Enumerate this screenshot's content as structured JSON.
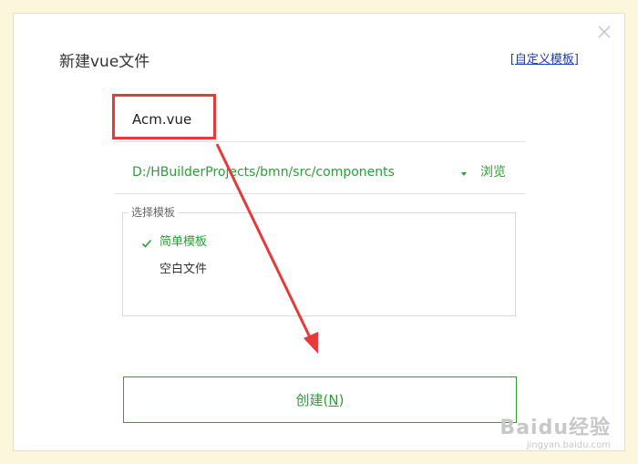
{
  "dialog": {
    "title": "新建vue文件",
    "custom_template_link": "[自定义模板]",
    "filename": "Acm.vue",
    "path": "D:/HBuilderProjects/bmn/src/components",
    "browse_label": "浏览",
    "template_group": {
      "legend": "选择模板",
      "items": [
        {
          "label": "简单模板",
          "selected": true
        },
        {
          "label": "空白文件",
          "selected": false
        }
      ]
    },
    "create_prefix": "创建(",
    "create_key": "N",
    "create_suffix": ")"
  },
  "watermark": {
    "main": "Baidu经验",
    "sub": "jingyan.baidu.com"
  },
  "colors": {
    "accent": "#2aa135",
    "highlight": "#e8393a",
    "link": "#1a3fbf",
    "page_background": "#fbf6dc"
  }
}
